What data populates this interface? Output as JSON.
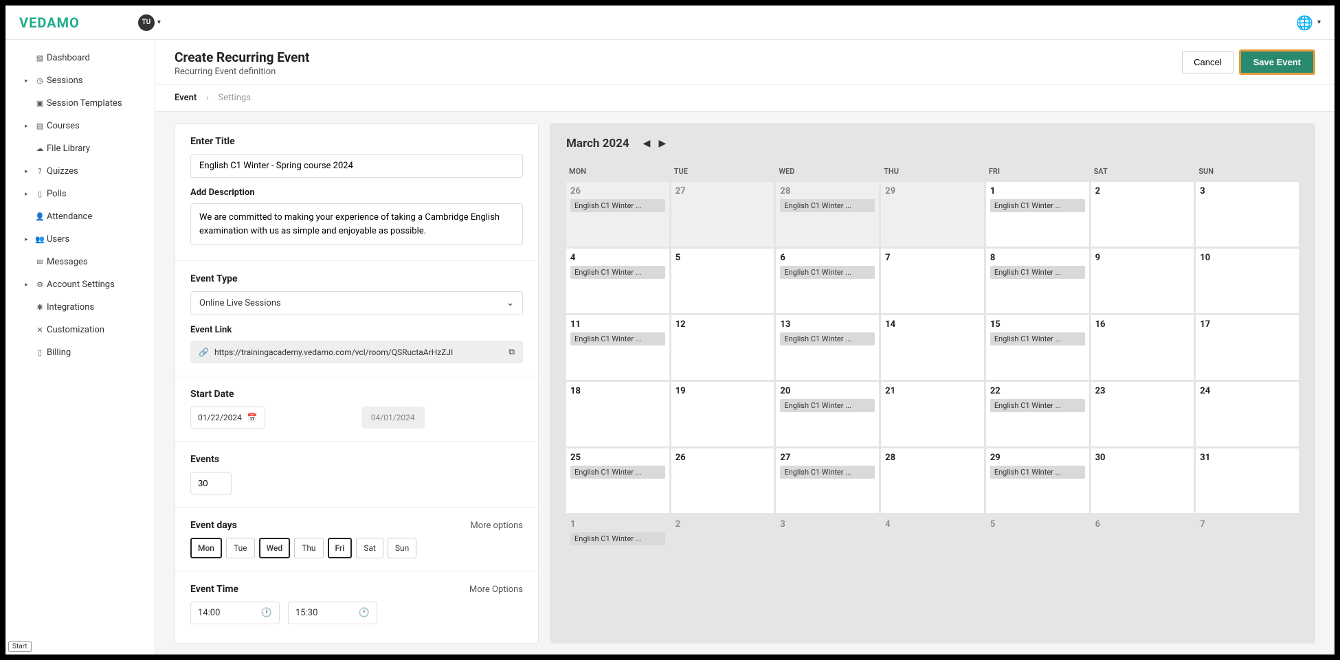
{
  "brand": "VEDAMO",
  "avatar_initials": "TU",
  "sidebar": {
    "items": [
      {
        "label": "Dashboard",
        "icon": "▧",
        "expandable": false
      },
      {
        "label": "Sessions",
        "icon": "◷",
        "expandable": true
      },
      {
        "label": "Session Templates",
        "icon": "▣",
        "expandable": false
      },
      {
        "label": "Courses",
        "icon": "▤",
        "expandable": true
      },
      {
        "label": "File Library",
        "icon": "☁",
        "expandable": false
      },
      {
        "label": "Quizzes",
        "icon": "?",
        "expandable": true
      },
      {
        "label": "Polls",
        "icon": "▯",
        "expandable": true
      },
      {
        "label": "Attendance",
        "icon": "👤",
        "expandable": false
      },
      {
        "label": "Users",
        "icon": "👥",
        "expandable": true
      },
      {
        "label": "Messages",
        "icon": "✉",
        "expandable": false
      },
      {
        "label": "Account Settings",
        "icon": "⚙",
        "expandable": true
      },
      {
        "label": "Integrations",
        "icon": "✱",
        "expandable": false
      },
      {
        "label": "Customization",
        "icon": "✕",
        "expandable": false
      },
      {
        "label": "Billing",
        "icon": "▯",
        "expandable": false
      }
    ]
  },
  "header": {
    "title": "Create Recurring Event",
    "subtitle": "Recurring Event definition",
    "cancel": "Cancel",
    "save": "Save Event"
  },
  "breadcrumb": {
    "step1": "Event",
    "step2": "Settings"
  },
  "form": {
    "title_label": "Enter Title",
    "title_value": "English C1 Winter - Spring course 2024",
    "desc_label": "Add Description",
    "desc_value": "We are committed to making your experience of taking a Cambridge English examination with us as simple and enjoyable as possible.",
    "type_label": "Event Type",
    "type_value": "Online Live Sessions",
    "link_label": "Event Link",
    "link_value": "https://trainingacademy.vedamo.com/vcl/room/QSRuctaArHzZJI",
    "start_label": "Start Date",
    "start_value": "01/22/2024",
    "end_ghost": "04/01/2024",
    "events_label": "Events",
    "events_value": "30",
    "days_label": "Event days",
    "more_options": "More options",
    "more_options2": "More Options",
    "days": [
      "Mon",
      "Tue",
      "Wed",
      "Thu",
      "Fri",
      "Sat",
      "Sun"
    ],
    "days_selected": [
      true,
      false,
      true,
      false,
      true,
      false,
      false
    ],
    "time_label": "Event Time",
    "time_start": "14:00",
    "time_end": "15:30"
  },
  "calendar": {
    "month_label": "March 2024",
    "dow": [
      "MON",
      "TUE",
      "WED",
      "THU",
      "FRI",
      "SAT",
      "SUN"
    ],
    "event_chip": "English C1 Winter ...",
    "cells": [
      {
        "n": "26",
        "prev": true,
        "ev": true
      },
      {
        "n": "27",
        "prev": true
      },
      {
        "n": "28",
        "prev": true,
        "ev": true
      },
      {
        "n": "29",
        "prev": true
      },
      {
        "n": "1",
        "ev": true
      },
      {
        "n": "2"
      },
      {
        "n": "3"
      },
      {
        "n": "4",
        "ev": true
      },
      {
        "n": "5"
      },
      {
        "n": "6",
        "ev": true
      },
      {
        "n": "7"
      },
      {
        "n": "8",
        "ev": true
      },
      {
        "n": "9"
      },
      {
        "n": "10"
      },
      {
        "n": "11",
        "ev": true
      },
      {
        "n": "12"
      },
      {
        "n": "13",
        "ev": true
      },
      {
        "n": "14"
      },
      {
        "n": "15",
        "ev": true
      },
      {
        "n": "16"
      },
      {
        "n": "17"
      },
      {
        "n": "18"
      },
      {
        "n": "19"
      },
      {
        "n": "20",
        "ev": true
      },
      {
        "n": "21"
      },
      {
        "n": "22",
        "ev": true
      },
      {
        "n": "23"
      },
      {
        "n": "24"
      },
      {
        "n": "25",
        "ev": true
      },
      {
        "n": "26"
      },
      {
        "n": "27",
        "ev": true
      },
      {
        "n": "28"
      },
      {
        "n": "29",
        "ev": true
      },
      {
        "n": "30"
      },
      {
        "n": "31"
      },
      {
        "n": "1",
        "other": true,
        "ev": true
      },
      {
        "n": "2",
        "other": true
      },
      {
        "n": "3",
        "other": true
      },
      {
        "n": "4",
        "other": true
      },
      {
        "n": "5",
        "other": true
      },
      {
        "n": "6",
        "other": true
      },
      {
        "n": "7",
        "other": true
      }
    ]
  },
  "start_badge": "Start"
}
